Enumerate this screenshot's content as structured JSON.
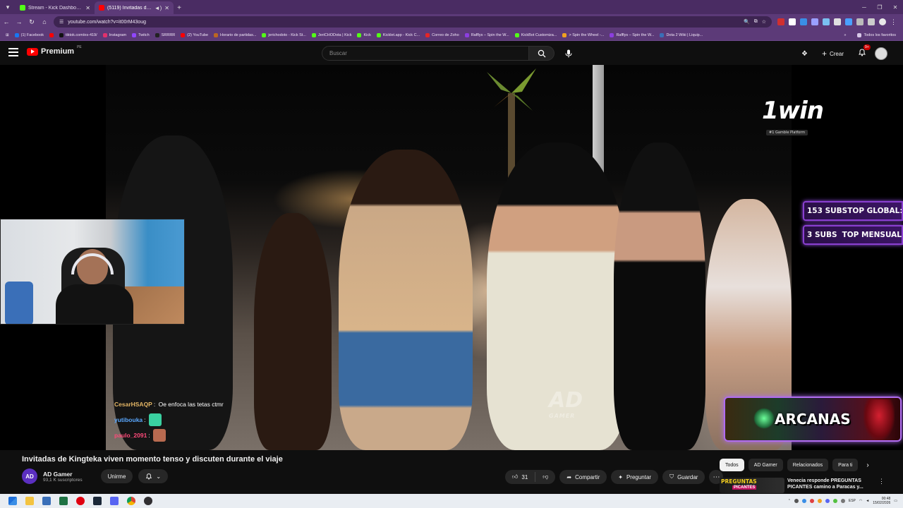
{
  "browser": {
    "tabs": [
      {
        "title": "Stream - Kick Dashboard",
        "favicon_color": "#53fc18",
        "active": false
      },
      {
        "title": "(5119) Invitadas de Kingteka",
        "favicon_color": "#ff0000",
        "active": true
      }
    ],
    "url": "youtube.com/watch?v=it00rM43oug",
    "bookmarks": [
      {
        "label": "(1) Facebook",
        "color": "#1877f2"
      },
      {
        "label": "",
        "color": "#ff0000"
      },
      {
        "label": "tiktok.com/es-419/",
        "color": "#111111"
      },
      {
        "label": "Instagram",
        "color": "#e1306c"
      },
      {
        "label": "Twitch",
        "color": "#9146ff"
      },
      {
        "label": "SRRRR",
        "color": "#222222"
      },
      {
        "label": "(2) YouTube",
        "color": "#ff0000"
      },
      {
        "label": "Horario de partidas...",
        "color": "#bb6622"
      },
      {
        "label": "jerichodoto - Kick St...",
        "color": "#53fc18"
      },
      {
        "label": "JeriCHODota | Kick",
        "color": "#53fc18"
      },
      {
        "label": "Kick",
        "color": "#53fc18"
      },
      {
        "label": "Kicklet.app - Kick C...",
        "color": "#53fc18"
      },
      {
        "label": "Correo de Zoho",
        "color": "#e42527"
      },
      {
        "label": "Rafflys – Spin the W...",
        "color": "#8c3ee0"
      },
      {
        "label": "KickBot Customiza...",
        "color": "#53fc18"
      },
      {
        "label": "> Spin the Wheel -...",
        "color": "#f0a020"
      },
      {
        "label": "Rafflys – Spin the W...",
        "color": "#8c3ee0"
      },
      {
        "label": "Dota 2 Wiki | Liquip...",
        "color": "#3a6fb8"
      }
    ],
    "all_favorites": "Todos los favoritos"
  },
  "youtube": {
    "brand": "Premium",
    "region": "PE",
    "search_placeholder": "Buscar",
    "create_label": "Crear",
    "notification_count": "9+"
  },
  "overlay": {
    "sponsor_logo": "1win",
    "sponsor_tag": "#1 Gamble Platform",
    "subs_lines": [
      {
        "count": "153 SUBS",
        "label": "TOP GLOBAL: TI"
      },
      {
        "count": "3 SUBS",
        "label": "TOP MENSUAL"
      }
    ],
    "chat": [
      {
        "user": "CesarHSAQP",
        "user_color": "#e3b565",
        "text": "Oe enfoca las tetas ctmr",
        "emote": ""
      },
      {
        "user": "yutibouka",
        "user_color": "#5aa8ff",
        "text": "",
        "emote": "#3ad0a0"
      },
      {
        "user": "paulo_2091",
        "user_color": "#ff4a7a",
        "text": "",
        "emote": "#b86a50"
      }
    ],
    "watermark": "AD",
    "watermark_sub": "GAMER",
    "banner_label": "ARCANAS"
  },
  "video": {
    "title": "Invitadas de Kingteka viven momento tenso y discuten durante el viaje",
    "channel_initials": "AD",
    "channel_name": "AD Gamer",
    "subscribers": "93,1 K suscriptores",
    "join_label": "Unirme",
    "likes": "31",
    "share_label": "Compartir",
    "ask_label": "Preguntar",
    "save_label": "Guardar"
  },
  "sidebar": {
    "chips": [
      "Todos",
      "AD Gamer",
      "Relacionados",
      "Para ti"
    ],
    "recommendation": {
      "thumb_line1": "PREGUNTAS",
      "thumb_line2": "PICANTES",
      "title": "Venecia responde PREGUNTAS PICANTES camino a Paracas y..."
    }
  },
  "taskbar": {
    "language": "ESP",
    "time": "00:48",
    "date": "15/02/2026"
  }
}
